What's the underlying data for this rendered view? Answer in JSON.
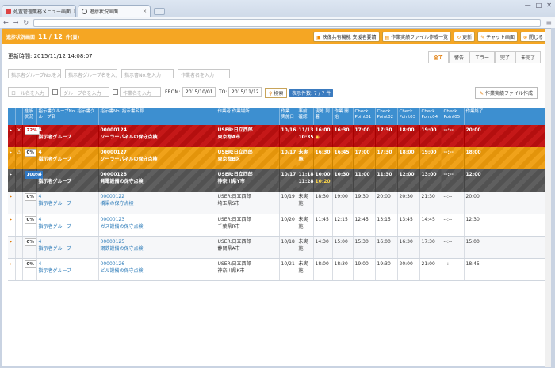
{
  "browser": {
    "tabs": [
      {
        "label": "処置管理業務メニュー画面"
      },
      {
        "label": "進捗状況画面"
      }
    ],
    "win_min": "—",
    "win_max": "□",
    "win_close": "✕"
  },
  "header": {
    "title": "進捗状況画面",
    "count": "11 / 12",
    "count_unit": "件(頁)",
    "buttons": [
      {
        "label": "映像共有機能 支援者要請"
      },
      {
        "label": "作業実績ファイル作成一覧"
      },
      {
        "label": "更新"
      },
      {
        "label": "チャット画面"
      },
      {
        "label": "閉じる"
      }
    ]
  },
  "updated": {
    "label": "更新時間:",
    "value": "2015/11/12 14:08:07"
  },
  "filters": [
    "全て",
    "警告",
    "エラー",
    "完了",
    "未完了"
  ],
  "search": {
    "group_no": "指示者グループNo.を入力",
    "group_name": "指示者グループ名を入力",
    "instr_no": "指示書No.を入力",
    "worker_name": "作業者名を入力",
    "role_name": "ロール名を入力",
    "group_name2": "グループ名を入力",
    "task_name": "作業名を入力",
    "from_label": "FROM:",
    "from_value": "2015/10/01",
    "to_label": "TO:",
    "to_value": "2015/11/12",
    "search_button": "検索",
    "result_badge": "表示件数: 7 / 7 件",
    "create_button": "作業実績ファイル作成"
  },
  "table": {
    "headers": [
      "",
      "",
      "進捗状況",
      "指示書グループNo. 指示書グループ名",
      "指示書No. 指示書名称",
      "作業者 作業場所",
      "作業 実施日",
      "事前 確認",
      "現地 到着",
      "作業 開始",
      "Check Point01",
      "Check Point02",
      "Check Point03",
      "Check Point04",
      "Check Point05",
      "作業終了"
    ],
    "rows": [
      {
        "status": "red",
        "icon": "✕",
        "pct": "22%",
        "gno": "4",
        "gname": "指示者グループ",
        "ino": "00000124",
        "iname": "ソーラーパネルの保守点検",
        "user": "USER:日立西郎",
        "place": "東京都A市",
        "date": "10/16",
        "pre": "11/13",
        "pre2": "10:35",
        "arr": "16:00",
        "arr2": "◉",
        "start": "16:30",
        "c1": "17:00",
        "c2": "17:30",
        "c3": "18:00",
        "c4": "19:00",
        "c5": "--:--",
        "end": "20:00"
      },
      {
        "status": "orange",
        "icon": "⚠",
        "pct": "0%",
        "gno": "4",
        "gname": "指示者グループ",
        "ino": "00000127",
        "iname": "ソーラーパネルの保守点検",
        "user": "USER:日立西郎",
        "place": "東京都B区",
        "date": "10/17",
        "pre": "未実施",
        "pre2": "",
        "arr": "16:30",
        "arr2": "",
        "start": "16:45",
        "c1": "17:00",
        "c2": "17:30",
        "c3": "18:00",
        "c4": "19:00",
        "c5": "--:--",
        "end": "18:00"
      },
      {
        "status": "gray",
        "icon": "",
        "pct": "100%",
        "gno": "4",
        "gname": "指示者グループ",
        "ino": "00000128",
        "iname": "発電設備の保守点検",
        "user": "USER:日立西郎",
        "place": "神奈川県Y市",
        "date": "10/17",
        "pre": "11:18",
        "pre2": "11:28",
        "arr": "10:00",
        "arr2": "10:20",
        "start": "10:30",
        "c1": "11:00",
        "c2": "11:30",
        "c3": "12:00",
        "c4": "13:00",
        "c5": "--:--",
        "end": "12:00"
      },
      {
        "status": "norm",
        "icon": "",
        "pct": "0%",
        "gno": "4",
        "gname": "指示者グループ",
        "ino": "00000122",
        "iname": "橋梁の保守点検",
        "user": "USER:日立西郎",
        "place": "埼玉県S市",
        "date": "10/19",
        "pre": "未実施",
        "pre2": "",
        "arr": "18:30",
        "arr2": "",
        "start": "19:00",
        "c1": "19:30",
        "c2": "20:00",
        "c3": "20:30",
        "c4": "21:30",
        "c5": "--:--",
        "end": "20:00"
      },
      {
        "status": "norm",
        "icon": "",
        "pct": "0%",
        "gno": "4",
        "gname": "指示者グループ",
        "ino": "00000123",
        "iname": "ガス設備の保守点検",
        "user": "USER:日立西郎",
        "place": "千葉県R市",
        "date": "10/20",
        "pre": "未実施",
        "pre2": "",
        "arr": "11:45",
        "arr2": "",
        "start": "12:15",
        "c1": "12:45",
        "c2": "13:15",
        "c3": "13:45",
        "c4": "14:45",
        "c5": "--:--",
        "end": "12:30"
      },
      {
        "status": "norm",
        "icon": "",
        "pct": "0%",
        "gno": "4",
        "gname": "指示者グループ",
        "ino": "00000125",
        "iname": "鋼鉄設備の保守点検",
        "user": "USER:日立西郎",
        "place": "静岡県A市",
        "date": "10/18",
        "pre": "未実施",
        "pre2": "",
        "arr": "14:30",
        "arr2": "",
        "start": "15:00",
        "c1": "15:30",
        "c2": "16:00",
        "c3": "16:30",
        "c4": "17:30",
        "c5": "--:--",
        "end": "15:00"
      },
      {
        "status": "norm",
        "icon": "",
        "pct": "0%",
        "gno": "4",
        "gname": "指示者グループ",
        "ino": "00000126",
        "iname": "ビル設備の保守点検",
        "user": "USER:日立西郎",
        "place": "神奈川県K市",
        "date": "10/21",
        "pre": "未実施",
        "pre2": "",
        "arr": "18:00",
        "arr2": "",
        "start": "18:30",
        "c1": "19:00",
        "c2": "19:30",
        "c3": "20:00",
        "c4": "21:00",
        "c5": "--:--",
        "end": "18:45"
      }
    ]
  },
  "colors": {
    "accent": "#f5a623",
    "table_header": "#3d8fd0",
    "error": "#c51818",
    "warning": "#f0a21a",
    "done": "#5f5f5f"
  }
}
